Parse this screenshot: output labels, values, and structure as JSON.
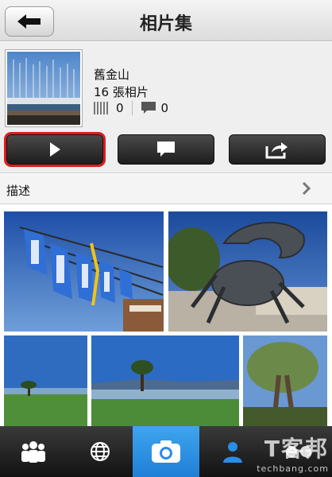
{
  "header": {
    "title": "相片集",
    "back_icon": "back-arrow-icon"
  },
  "album": {
    "name": "舊金山",
    "photo_count": "16 張相片",
    "views": "0",
    "comments": "0"
  },
  "actions": {
    "play_icon": "play-icon",
    "comment_icon": "comment-icon",
    "share_icon": "share-icon"
  },
  "description": {
    "label": "描述",
    "chevron_icon": "chevron-right-icon"
  },
  "tabbar": {
    "tabs": [
      {
        "icon": "people-icon",
        "active": false
      },
      {
        "icon": "globe-icon",
        "active": false
      },
      {
        "icon": "camera-icon",
        "active": true
      },
      {
        "icon": "person-icon",
        "active": false
      },
      {
        "icon": "more-icon",
        "active": false
      }
    ]
  },
  "watermark": {
    "cn": "T客邦",
    "en": "techbang.com"
  },
  "colors": {
    "accent": "#2a8de6",
    "selection_outline": "#e11b1b",
    "tab_bg": "#1a1a1a"
  }
}
